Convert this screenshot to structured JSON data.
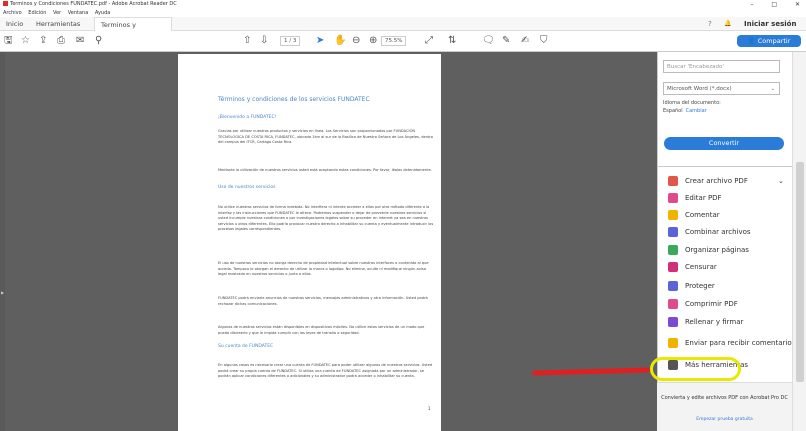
{
  "window": {
    "title": "Terminos y Condiciones FUNDATEC.pdf - Adobe Acrobat Reader DC",
    "controls": [
      "–",
      "□",
      "✕"
    ]
  },
  "menu": [
    "Archivo",
    "Edición",
    "Ver",
    "Ventana",
    "Ayuda"
  ],
  "tabs": {
    "home": "Inicio",
    "tools": "Herramientas",
    "document": "Terminos y Condic...",
    "close": "×"
  },
  "header_right": {
    "help": "?",
    "bell": "🔔",
    "signin": "Iniciar sesión"
  },
  "toolbar": {
    "page_current": "1",
    "page_total": "/ 3",
    "zoom": "75.5%",
    "share_label": "Compartir"
  },
  "document": {
    "title": "Términos y condiciones de los servicios FUNDATEC",
    "welcome": "¡Bienvenido a FUNDATEC!",
    "p1": "Gracias por utilizar nuestros productos y servicios en línea. Los Servicios son proporcionados por FUNDACIÓN TECNOLÓGICA DE COSTA RICA, FUNDATEC, ubicada 1km al sur de la Basílica de Nuestra Señora de Los Ángeles, dentro del campus del ITCR, Cartago Costa Rica.",
    "p2": "Mediante la utilización de nuestros servicios usted está aceptando estas condiciones. Por favor, léalas detenidamente.",
    "h_uso": "Uso de nuestros servicios",
    "p3": "No utilice nuestros servicios de forma indebida. No interfiera ni intente acceder a ellos por otro método diferente a la interfaz y las instrucciones que FUNDATEC le ofrece. Podremos suspender o dejar de proveerle nuestros servicios si usted incumple nuestras condiciones o por investigaciones legales sobre su proceder en internet ya sea en nuestros servicios u otros diferentes. Ello podría provocar nuestro derecho a inhabilitar su cuenta y eventualmente introducir los procesos legales correspondientes.",
    "p4": "El uso de nuestros servicios no otorga derecho de propiedad intelectual sobre nuestras interfaces o contenido al que acceda. Tampoco le otorgan el derecho de utilizar la marca o logotipo. No elimine, oculte ni modifique ningún aviso legal mostrado en nuestros servicios o junto a ellos.",
    "p5": "FUNDATEC podrá enviarle anuncios de nuestros servicios, mensajes administrativos y otra información. Usted podrá rechazar dichas comunicaciones.",
    "p6": "Algunos de nuestros servicios están disponibles en dispositivos móviles. No utilice estos servicios de un modo que pueda distraerlo y que le impida cumplir con las leyes de tránsito o seguridad.",
    "h_cuenta": "Su cuenta de FUNDATEC",
    "p7": "En algunos casos es necesario crear una cuenta de FUNDATEC para poder utilizar algunos de nuestros servicios. Usted podrá crear su propia cuenta de FUNDATEC. Si utiliza una cuenta de FUNDATEC asignada por un administrador, se podrán aplicar condiciones diferentes o adicionales y su administrador podrá acceder o inhabilitar su cuenta.",
    "page_number": "1"
  },
  "panel": {
    "search_placeholder": "Buscar 'Encabezado'",
    "format_select": "Microsoft Word (*.docx)",
    "lang_label": "Idioma del documento:",
    "lang_value": "Español",
    "lang_change": "Cambiar",
    "convert_label": "Convertir",
    "tools": [
      {
        "label": "Crear archivo PDF",
        "icon": "create-pdf-icon",
        "color": "#e0574d"
      },
      {
        "label": "Editar PDF",
        "icon": "edit-pdf-icon",
        "color": "#e04a8a"
      },
      {
        "label": "Comentar",
        "icon": "comment-icon",
        "color": "#f0b400"
      },
      {
        "label": "Combinar archivos",
        "icon": "combine-icon",
        "color": "#5a63d8"
      },
      {
        "label": "Organizar páginas",
        "icon": "organize-icon",
        "color": "#3aaa5a"
      },
      {
        "label": "Censurar",
        "icon": "redact-icon",
        "color": "#d0307a"
      },
      {
        "label": "Proteger",
        "icon": "shield-icon",
        "color": "#5a63d8"
      },
      {
        "label": "Comprimir PDF",
        "icon": "compress-icon",
        "color": "#e04a8a"
      },
      {
        "label": "Rellenar y firmar",
        "icon": "fill-sign-icon",
        "color": "#7b4bd6"
      },
      {
        "label": "Enviar para recibir comentarios",
        "icon": "send-comments-icon",
        "color": "#f0b400"
      },
      {
        "label": "Más herramientas",
        "icon": "more-tools-icon",
        "color": "#555555"
      }
    ],
    "promo_text": "Convierta y edite archivos PDF con Acrobat Pro DC",
    "promo_link": "Empezar prueba gratuita"
  }
}
